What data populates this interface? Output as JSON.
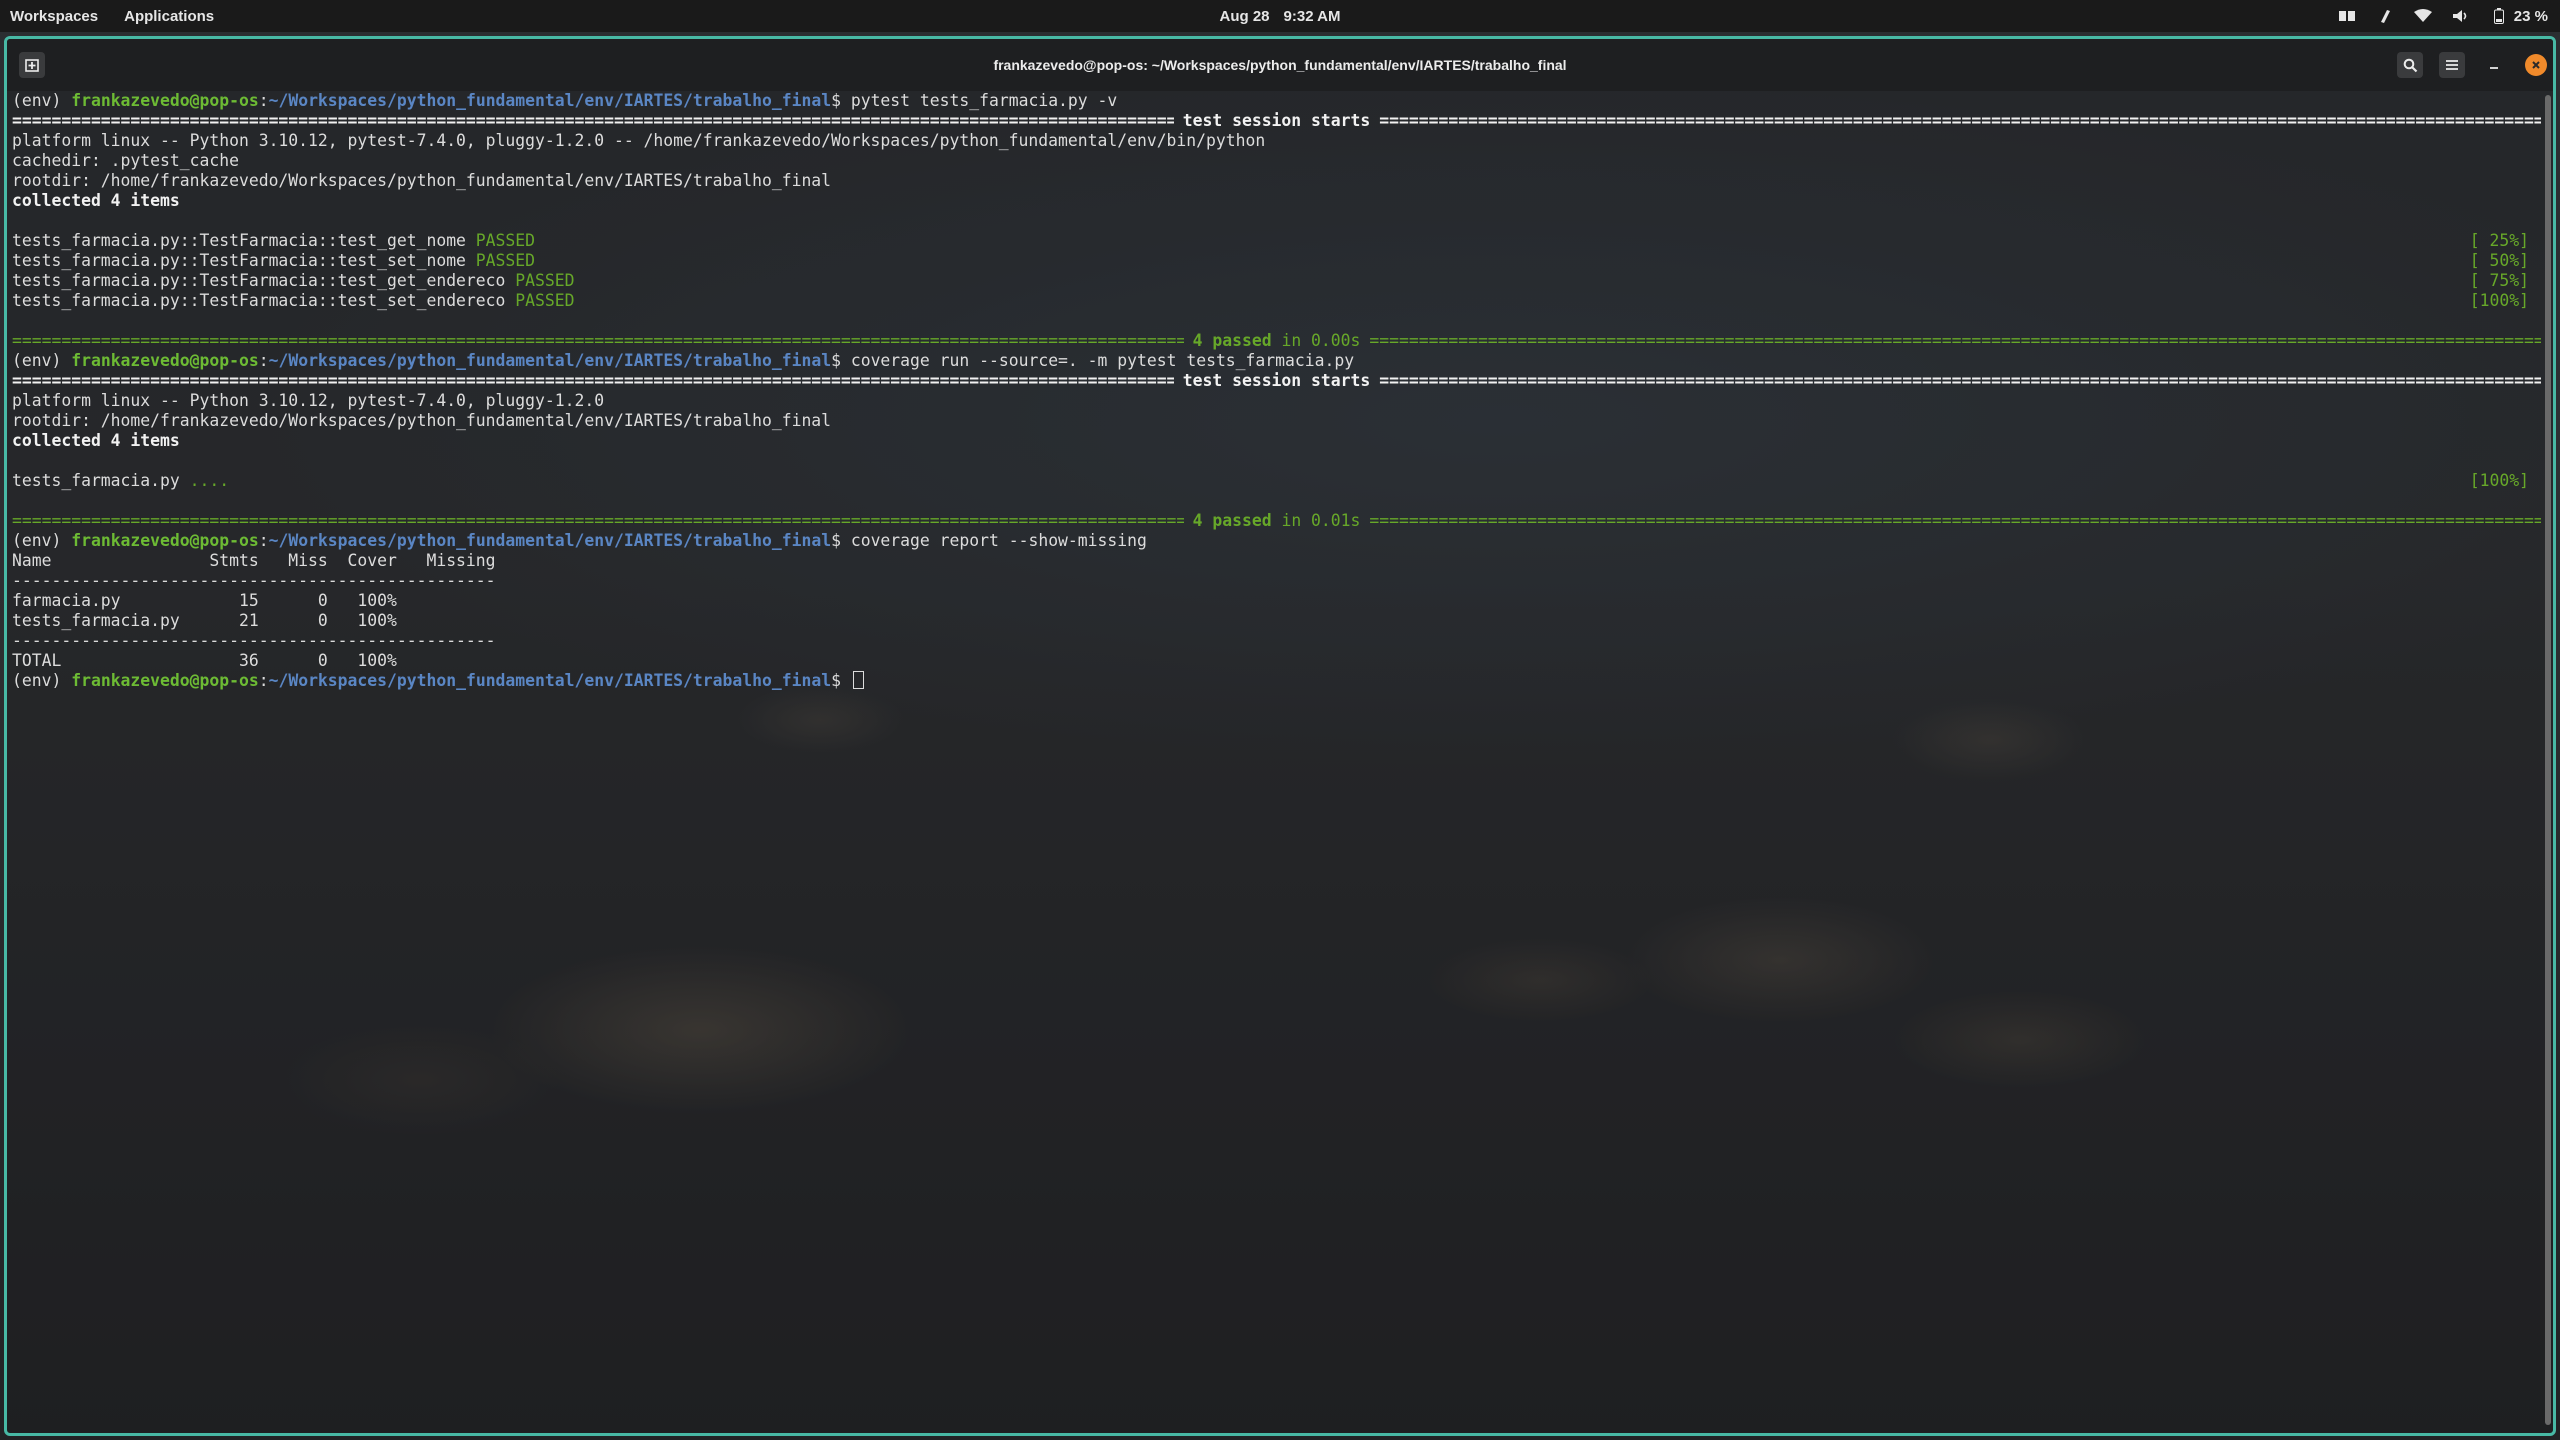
{
  "top_panel": {
    "workspaces": "Workspaces",
    "applications": "Applications",
    "date": "Aug 28",
    "time": "9:32 AM",
    "battery": "23 %"
  },
  "window": {
    "title": "frankazevedo@pop-os: ~/Workspaces/python_fundamental/env/IARTES/trabalho_final"
  },
  "terminal": {
    "env": "(env) ",
    "user": "frankazevedo@pop-os",
    "colon": ":",
    "path": "~/Workspaces/python_fundamental/env/IARTES/trabalho_final",
    "dollar": "$ ",
    "cmd1": "pytest tests_farmacia.py -v",
    "session_label": "test session starts",
    "platform1": "platform linux -- Python 3.10.12, pytest-7.4.0, pluggy-1.2.0 -- /home/frankazevedo/Workspaces/python_fundamental/env/bin/python",
    "cachedir": "cachedir: .pytest_cache",
    "rootdir": "rootdir: /home/frankazevedo/Workspaces/python_fundamental/env/IARTES/trabalho_final",
    "collected": "collected 4 items",
    "tests": [
      {
        "name": "tests_farmacia.py::TestFarmacia::test_get_nome ",
        "status": "PASSED",
        "pct": "[ 25%]"
      },
      {
        "name": "tests_farmacia.py::TestFarmacia::test_set_nome ",
        "status": "PASSED",
        "pct": "[ 50%]"
      },
      {
        "name": "tests_farmacia.py::TestFarmacia::test_get_endereco ",
        "status": "PASSED",
        "pct": "[ 75%]"
      },
      {
        "name": "tests_farmacia.py::TestFarmacia::test_set_endereco ",
        "status": "PASSED",
        "pct": "[100%]"
      }
    ],
    "passed1_count": "4 passed",
    "passed1_time": " in 0.00s",
    "cmd2": "coverage run --source=. -m pytest tests_farmacia.py",
    "platform2": "platform linux -- Python 3.10.12, pytest-7.4.0, pluggy-1.2.0",
    "run_file": "tests_farmacia.py ",
    "run_dots": "....",
    "run_pct": "[100%]",
    "passed2_count": "4 passed",
    "passed2_time": " in 0.01s",
    "cmd3": "coverage report --show-missing",
    "report_header": "Name                Stmts   Miss  Cover   Missing",
    "report_rule": "-------------------------------------------------",
    "report_rows": [
      "farmacia.py            15      0   100%",
      "tests_farmacia.py      21      0   100%"
    ],
    "report_total": "TOTAL                  36      0   100%"
  }
}
